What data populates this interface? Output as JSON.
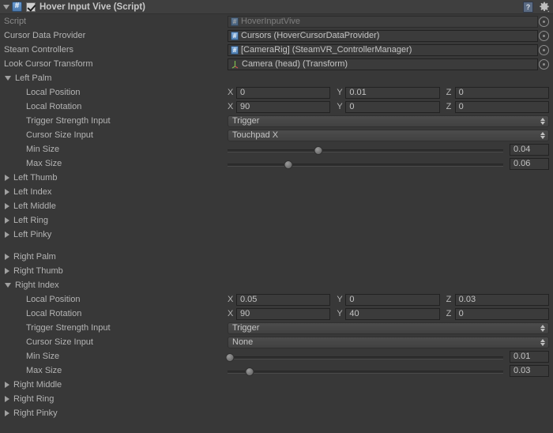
{
  "header": {
    "title": "Hover Input Vive (Script)",
    "enabled": true,
    "script_icon": "csharp-script-icon",
    "help_icon": "help-book-icon",
    "gear_icon": "gear-icon"
  },
  "top_fields": [
    {
      "label": "Script",
      "value": "HoverInputVive",
      "icon": "script-icon",
      "disabled": true
    },
    {
      "label": "Cursor Data Provider",
      "value": "Cursors (HoverCursorDataProvider)",
      "icon": "script-icon",
      "disabled": false
    },
    {
      "label": "Steam Controllers",
      "value": "[CameraRig] (SteamVR_ControllerManager)",
      "icon": "script-icon",
      "disabled": false
    },
    {
      "label": "Look Cursor Transform",
      "value": "Camera (head) (Transform)",
      "icon": "transform-icon",
      "disabled": false
    }
  ],
  "axes": {
    "x": "X",
    "y": "Y",
    "z": "Z"
  },
  "field_labels": {
    "local_position": "Local Position",
    "local_rotation": "Local Rotation",
    "trigger_strength_input": "Trigger Strength Input",
    "cursor_size_input": "Cursor Size Input",
    "min_size": "Min Size",
    "max_size": "Max Size"
  },
  "groups": [
    {
      "name": "Left Palm",
      "expanded": true,
      "local_position": {
        "x": "0",
        "y": "0.01",
        "z": "0"
      },
      "local_rotation": {
        "x": "90",
        "y": "0",
        "z": "0"
      },
      "trigger_strength_input": "Trigger",
      "cursor_size_input": "Touchpad X",
      "min_size": {
        "value": "0.04",
        "pct": 33
      },
      "max_size": {
        "value": "0.06",
        "pct": 22
      }
    },
    {
      "name": "Left Thumb",
      "expanded": false
    },
    {
      "name": "Left Index",
      "expanded": false
    },
    {
      "name": "Left Middle",
      "expanded": false
    },
    {
      "name": "Left Ring",
      "expanded": false
    },
    {
      "name": "Left Pinky",
      "expanded": false
    },
    {
      "gap": true
    },
    {
      "name": "Right Palm",
      "expanded": false
    },
    {
      "name": "Right Thumb",
      "expanded": false
    },
    {
      "name": "Right Index",
      "expanded": true,
      "local_position": {
        "x": "0.05",
        "y": "0",
        "z": "0.03"
      },
      "local_rotation": {
        "x": "90",
        "y": "40",
        "z": "0"
      },
      "trigger_strength_input": "Trigger",
      "cursor_size_input": "None",
      "min_size": {
        "value": "0.01",
        "pct": 1
      },
      "max_size": {
        "value": "0.03",
        "pct": 8
      }
    },
    {
      "name": "Right Middle",
      "expanded": false
    },
    {
      "name": "Right Ring",
      "expanded": false
    },
    {
      "name": "Right Pinky",
      "expanded": false
    }
  ],
  "colors": {
    "background": "#383838",
    "header_bar": "#3f3f3f",
    "field_bg": "#3b3b3b",
    "text": "#b4b4b4",
    "script_icon_blue": "#5282b4"
  }
}
